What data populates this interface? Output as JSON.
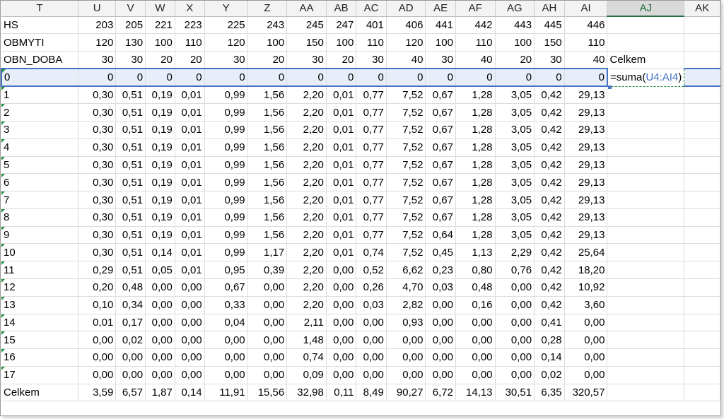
{
  "columns": [
    "T",
    "U",
    "V",
    "W",
    "X",
    "Y",
    "Z",
    "AA",
    "AB",
    "AC",
    "AD",
    "AE",
    "AF",
    "AG",
    "AH",
    "AI",
    "AJ",
    "AK"
  ],
  "active_column": "AJ",
  "rows": [
    {
      "label": "HS",
      "values": [
        "203",
        "205",
        "221",
        "223",
        "225",
        "243",
        "245",
        "247",
        "401",
        "406",
        "441",
        "442",
        "443",
        "445",
        "446"
      ],
      "aj": "",
      "ak": ""
    },
    {
      "label": "OBMYTI",
      "values": [
        "120",
        "130",
        "100",
        "110",
        "120",
        "100",
        "150",
        "100",
        "110",
        "120",
        "100",
        "110",
        "100",
        "150",
        "110"
      ],
      "aj": "",
      "ak": ""
    },
    {
      "label": "OBN_DOBA",
      "values": [
        "30",
        "30",
        "20",
        "20",
        "30",
        "20",
        "30",
        "20",
        "30",
        "40",
        "30",
        "40",
        "20",
        "30",
        "40"
      ],
      "aj": "Celkem",
      "ak": ""
    },
    {
      "label": "0",
      "values": [
        "0",
        "0",
        "0",
        "0",
        "0",
        "0",
        "0",
        "0",
        "0",
        "0",
        "0",
        "0",
        "0",
        "0",
        "0"
      ],
      "aj": "",
      "ak": "",
      "selected": true,
      "marker": true
    },
    {
      "label": "1",
      "values": [
        "0,30",
        "0,51",
        "0,19",
        "0,01",
        "0,99",
        "1,56",
        "2,20",
        "0,01",
        "0,77",
        "7,52",
        "0,67",
        "1,28",
        "3,05",
        "0,42",
        "29,13"
      ],
      "marker": true
    },
    {
      "label": "2",
      "values": [
        "0,30",
        "0,51",
        "0,19",
        "0,01",
        "0,99",
        "1,56",
        "2,20",
        "0,01",
        "0,77",
        "7,52",
        "0,67",
        "1,28",
        "3,05",
        "0,42",
        "29,13"
      ],
      "marker": true
    },
    {
      "label": "3",
      "values": [
        "0,30",
        "0,51",
        "0,19",
        "0,01",
        "0,99",
        "1,56",
        "2,20",
        "0,01",
        "0,77",
        "7,52",
        "0,67",
        "1,28",
        "3,05",
        "0,42",
        "29,13"
      ],
      "marker": true
    },
    {
      "label": "4",
      "values": [
        "0,30",
        "0,51",
        "0,19",
        "0,01",
        "0,99",
        "1,56",
        "2,20",
        "0,01",
        "0,77",
        "7,52",
        "0,67",
        "1,28",
        "3,05",
        "0,42",
        "29,13"
      ],
      "marker": true
    },
    {
      "label": "5",
      "values": [
        "0,30",
        "0,51",
        "0,19",
        "0,01",
        "0,99",
        "1,56",
        "2,20",
        "0,01",
        "0,77",
        "7,52",
        "0,67",
        "1,28",
        "3,05",
        "0,42",
        "29,13"
      ],
      "marker": true
    },
    {
      "label": "6",
      "values": [
        "0,30",
        "0,51",
        "0,19",
        "0,01",
        "0,99",
        "1,56",
        "2,20",
        "0,01",
        "0,77",
        "7,52",
        "0,67",
        "1,28",
        "3,05",
        "0,42",
        "29,13"
      ],
      "marker": true
    },
    {
      "label": "7",
      "values": [
        "0,30",
        "0,51",
        "0,19",
        "0,01",
        "0,99",
        "1,56",
        "2,20",
        "0,01",
        "0,77",
        "7,52",
        "0,67",
        "1,28",
        "3,05",
        "0,42",
        "29,13"
      ],
      "marker": true
    },
    {
      "label": "8",
      "values": [
        "0,30",
        "0,51",
        "0,19",
        "0,01",
        "0,99",
        "1,56",
        "2,20",
        "0,01",
        "0,77",
        "7,52",
        "0,67",
        "1,28",
        "3,05",
        "0,42",
        "29,13"
      ],
      "marker": true
    },
    {
      "label": "9",
      "values": [
        "0,30",
        "0,51",
        "0,19",
        "0,01",
        "0,99",
        "1,56",
        "2,20",
        "0,01",
        "0,77",
        "7,52",
        "0,64",
        "1,28",
        "3,05",
        "0,42",
        "29,13"
      ],
      "marker": true
    },
    {
      "label": "10",
      "values": [
        "0,30",
        "0,51",
        "0,14",
        "0,01",
        "0,99",
        "1,17",
        "2,20",
        "0,01",
        "0,74",
        "7,52",
        "0,45",
        "1,13",
        "2,29",
        "0,42",
        "25,64"
      ],
      "marker": true
    },
    {
      "label": "11",
      "values": [
        "0,29",
        "0,51",
        "0,05",
        "0,01",
        "0,95",
        "0,39",
        "2,20",
        "0,00",
        "0,52",
        "6,62",
        "0,23",
        "0,80",
        "0,76",
        "0,42",
        "18,20"
      ],
      "marker": true
    },
    {
      "label": "12",
      "values": [
        "0,20",
        "0,48",
        "0,00",
        "0,00",
        "0,67",
        "0,00",
        "2,20",
        "0,00",
        "0,26",
        "4,70",
        "0,03",
        "0,48",
        "0,00",
        "0,42",
        "10,92"
      ],
      "marker": true
    },
    {
      "label": "13",
      "values": [
        "0,10",
        "0,34",
        "0,00",
        "0,00",
        "0,33",
        "0,00",
        "2,20",
        "0,00",
        "0,03",
        "2,82",
        "0,00",
        "0,16",
        "0,00",
        "0,42",
        "3,60"
      ],
      "marker": true
    },
    {
      "label": "14",
      "values": [
        "0,01",
        "0,17",
        "0,00",
        "0,00",
        "0,04",
        "0,00",
        "2,11",
        "0,00",
        "0,00",
        "0,93",
        "0,00",
        "0,00",
        "0,00",
        "0,41",
        "0,00"
      ],
      "marker": true
    },
    {
      "label": "15",
      "values": [
        "0,00",
        "0,02",
        "0,00",
        "0,00",
        "0,00",
        "0,00",
        "1,48",
        "0,00",
        "0,00",
        "0,00",
        "0,00",
        "0,00",
        "0,00",
        "0,28",
        "0,00"
      ],
      "marker": true
    },
    {
      "label": "16",
      "values": [
        "0,00",
        "0,00",
        "0,00",
        "0,00",
        "0,00",
        "0,00",
        "0,74",
        "0,00",
        "0,00",
        "0,00",
        "0,00",
        "0,00",
        "0,00",
        "0,14",
        "0,00"
      ],
      "marker": true
    },
    {
      "label": "17",
      "values": [
        "0,00",
        "0,00",
        "0,00",
        "0,00",
        "0,00",
        "0,00",
        "0,09",
        "0,00",
        "0,00",
        "0,00",
        "0,00",
        "0,00",
        "0,00",
        "0,02",
        "0,00"
      ],
      "marker": true
    },
    {
      "label": "Celkem",
      "values": [
        "3,59",
        "6,57",
        "1,87",
        "0,14",
        "11,91",
        "15,56",
        "32,98",
        "0,11",
        "8,49",
        "90,27",
        "6,72",
        "14,13",
        "30,51",
        "6,35",
        "320,57"
      ]
    }
  ],
  "formula": {
    "prefix": "=suma(",
    "range": "U4:AI4",
    "suffix": ")"
  },
  "colors": {
    "selection": "#4472c4",
    "marker": "#1f8f3a",
    "header_bg": "#f3f3f3",
    "active_header": "#217346"
  }
}
